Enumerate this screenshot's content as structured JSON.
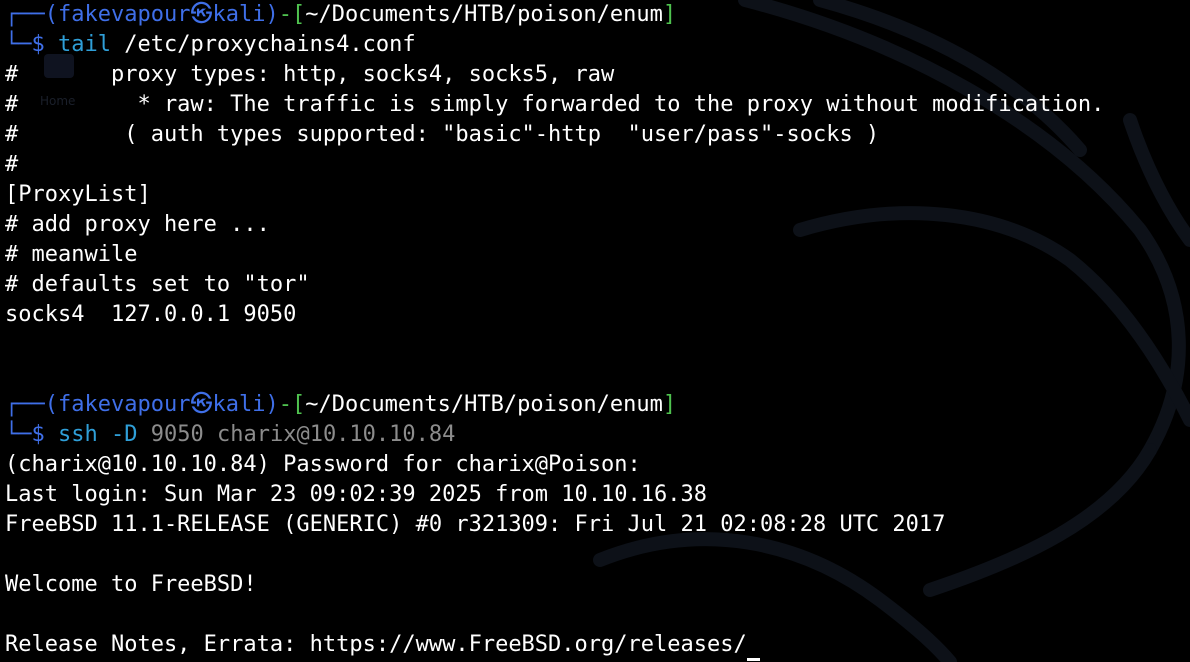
{
  "prompt1": {
    "corner_top": "┌──",
    "open_paren": "(",
    "user": "fakevapour",
    "at_symbol": "㉿",
    "host": "kali",
    "close_paren": ")",
    "dash": "-",
    "open_bracket": "[",
    "path": "~/Documents/HTB/poison/enum",
    "close_bracket": "]",
    "corner_bottom": "└─",
    "dollar": "$ ",
    "command": "tail",
    "args": " /etc/proxychains4.conf"
  },
  "output1": [
    "#       proxy types: http, socks4, socks5, raw",
    "#         * raw: The traffic is simply forwarded to the proxy without modification.",
    "#        ( auth types supported: \"basic\"-http  \"user/pass\"-socks )",
    "#",
    "[ProxyList]",
    "# add proxy here ...",
    "# meanwile",
    "# defaults set to \"tor\"",
    "socks4  127.0.0.1 9050"
  ],
  "prompt2": {
    "corner_top": "┌──",
    "open_paren": "(",
    "user": "fakevapour",
    "at_symbol": "㉿",
    "host": "kali",
    "close_paren": ")",
    "dash": "-",
    "open_bracket": "[",
    "path": "~/Documents/HTB/poison/enum",
    "close_bracket": "]",
    "corner_bottom": "└─",
    "dollar": "$ ",
    "command": "ssh",
    "flag": " -D",
    "port": " 9050",
    "target": " charix@10.10.10.84"
  },
  "output2": [
    "(charix@10.10.10.84) Password for charix@Poison:",
    "Last login: Sun Mar 23 09:02:39 2025 from 10.10.16.38",
    "FreeBSD 11.1-RELEASE (GENERIC) #0 r321309: Fri Jul 21 02:08:28 UTC 2017",
    "",
    "Welcome to FreeBSD!",
    "",
    "Release Notes, Errata: https://www.FreeBSD.org/releases/"
  ],
  "background": {
    "ghost_icon": "home-icon",
    "ghost_label": "Home"
  },
  "colors": {
    "background": "#000000",
    "prompt_frame": "#3f6fe8",
    "prompt_path": "#4fc24f",
    "command": "#2f9fd8",
    "text": "#ffffff",
    "dim_arg": "#8c8c8c"
  }
}
